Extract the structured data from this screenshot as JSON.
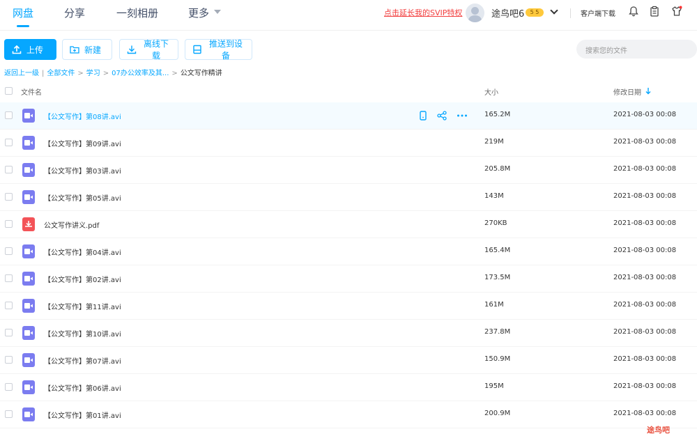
{
  "topnav": {
    "items": [
      "网盘",
      "分享",
      "一刻相册",
      "更多"
    ],
    "svip_link": "点击延长我的SVIP特权",
    "username": "途鸟吧6",
    "badge": "5 5",
    "client_download": "客户端下载"
  },
  "toolbar": {
    "upload": "上传",
    "new": "新建",
    "offline": "离线下载",
    "push": "推送到设备",
    "search_placeholder": "搜索您的文件"
  },
  "breadcrumb": {
    "back": "返回上一级",
    "all": "全部文件",
    "level1": "学习",
    "level2": "07办公效率及其...",
    "current": "公文写作精讲"
  },
  "table": {
    "col_name": "文件名",
    "col_size": "大小",
    "col_date": "修改日期",
    "rows": [
      {
        "name": "【公文写作】第08讲.avi",
        "size": "165.2M",
        "date": "2021-08-03 00:08",
        "type": "video"
      },
      {
        "name": "【公文写作】第09讲.avi",
        "size": "219M",
        "date": "2021-08-03 00:08",
        "type": "video"
      },
      {
        "name": "【公文写作】第03讲.avi",
        "size": "205.8M",
        "date": "2021-08-03 00:08",
        "type": "video"
      },
      {
        "name": "【公文写作】第05讲.avi",
        "size": "143M",
        "date": "2021-08-03 00:08",
        "type": "video"
      },
      {
        "name": "公文写作讲义.pdf",
        "size": "270KB",
        "date": "2021-08-03 00:08",
        "type": "pdf"
      },
      {
        "name": "【公文写作】第04讲.avi",
        "size": "165.4M",
        "date": "2021-08-03 00:08",
        "type": "video"
      },
      {
        "name": "【公文写作】第02讲.avi",
        "size": "173.5M",
        "date": "2021-08-03 00:08",
        "type": "video"
      },
      {
        "name": "【公文写作】第11讲.avi",
        "size": "161M",
        "date": "2021-08-03 00:08",
        "type": "video"
      },
      {
        "name": "【公文写作】第10讲.avi",
        "size": "237.8M",
        "date": "2021-08-03 00:08",
        "type": "video"
      },
      {
        "name": "【公文写作】第07讲.avi",
        "size": "150.9M",
        "date": "2021-08-03 00:08",
        "type": "video"
      },
      {
        "name": "【公文写作】第06讲.avi",
        "size": "195M",
        "date": "2021-08-03 00:08",
        "type": "video"
      },
      {
        "name": "【公文写作】第01讲.avi",
        "size": "200.9M",
        "date": "2021-08-03 00:08",
        "type": "video"
      }
    ]
  },
  "watermark": "途鸟吧"
}
